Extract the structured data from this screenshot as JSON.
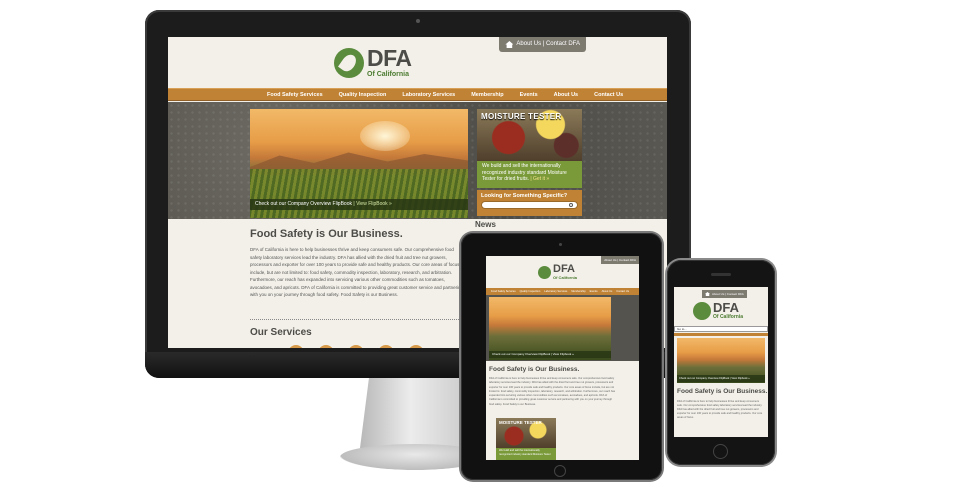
{
  "site": {
    "utility_links": "About Us | Contact DFA",
    "logo_main": "DFA",
    "logo_sub": "Of California",
    "nav": [
      "Food Safety Services",
      "Quality Inspection",
      "Laboratory Services",
      "Membership",
      "Events",
      "About Us",
      "Contact Us"
    ],
    "hero_caption_prefix": "Check out our Company Overview FlipBook",
    "hero_caption_link": "| View FlipBook »",
    "moisture_title": "MOISTURE TESTER",
    "moisture_text": "We build and sell the internationally recognized industry standard Moisture Tester for dried fruits.",
    "moisture_link": "| Get it »",
    "search_label": "Looking for Something Specific?",
    "news_heading": "News",
    "headline": "Food Safety is Our Business.",
    "paragraph": "DFA of California is here to help businesses thrive and keep consumers safe. Our comprehensive food safety laboratory services lead the industry. DFA has allied with the dried fruit and tree nut growers, processors and exporter for over 100 years to provide safe and healthy products. Our core areas of focus include, but are not limited to: food safety, commodity inspection, laboratory, research, and arbitration. Furthermore, our reach has expanded into servicing various other commodities such as tomatoes, avocadoes, and apricots. DFA of California is committed to providing great customer service and partnering with you on your journey through food safety. Food Safety is our Business.",
    "services_heading": "Our Services"
  },
  "tablet": {
    "utility_links": "About Us | Contact DFA",
    "nav": [
      "Food Safety Services",
      "Quality Inspection",
      "Laboratory Services",
      "Membership",
      "Events",
      "About Us",
      "Contact Us"
    ],
    "hero_caption": "Check out our Company Overview FlipBook | View Flipbook »",
    "headline": "Food Safety is Our Business.",
    "paragraph": "DFA of California is here to help businesses thrive and keep consumers safe. Our comprehensive food safety laboratory services lead the industry. DFA has allied with the dried fruit and tree nut growers, processors and exporter for over 100 years to provide safe and healthy products. Our core areas of focus include, but are not limited to: food safety, commodity inspection, laboratory, research, and arbitration. Furthermore, our reach has expanded into servicing various other commodities such as tomatoes, avocadoes, and apricots. DFA of California is committed to providing great customer service and partnering with you on your journey through food safety. Food Safety is our Business.",
    "moisture_title": "MOISTURE TESTER",
    "moisture_text": "We build and sell the internationally recognized industry standard Moisture Tester"
  },
  "phone": {
    "utility_links": "About Us | Contact DFA",
    "goto_label": "Go to...",
    "hero_caption": "Check out our Company Overview FlipBook | View Flipbook »",
    "headline": "Food Safety is Our Business.",
    "paragraph": "DFA of California is here to help businesses thrive and keep consumers safe. Our comprehensive food safety laboratory services lead the industry. DFA has allied with the dried fruit and tree nut growers, processors and exporter for over 100 years to provide safe and healthy products. Our core areas of focus"
  }
}
